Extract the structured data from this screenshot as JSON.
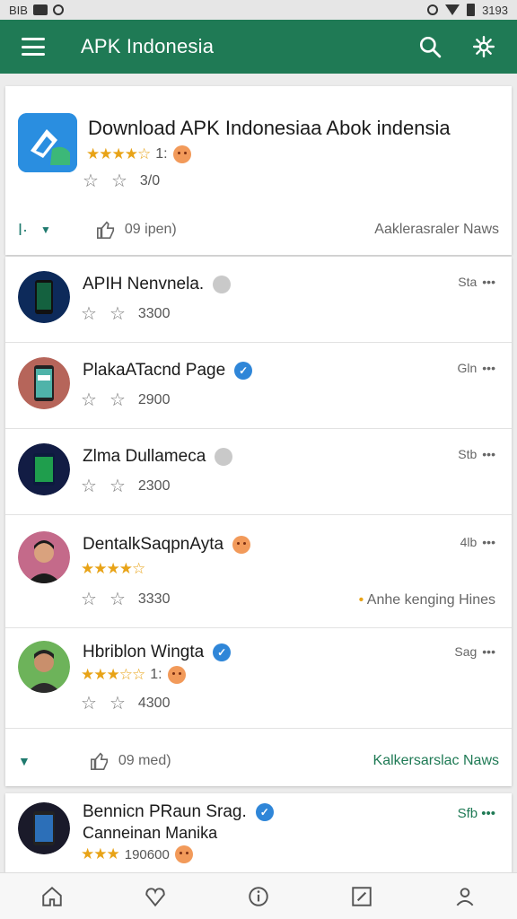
{
  "status_bar": {
    "left_text": "BIB",
    "right_text": "3193"
  },
  "app_bar": {
    "title": "APK Indonesia",
    "menu_icon": "hamburger-icon",
    "search_icon": "search-icon",
    "settings_icon": "gear-icon"
  },
  "featured": {
    "title": "Download APK Indonesiaa Abok indensia",
    "rating_count": "1:",
    "meta_value": "3/0",
    "footer_left": "I·",
    "like_text": "09 ipen)",
    "footer_right": "Aaklerasraler Naws"
  },
  "items": [
    {
      "name": "APIH Nenvnela.",
      "badge": "grey",
      "time": "Sta",
      "meta": "3300",
      "rating": "",
      "side": ""
    },
    {
      "name": "PlakaATacnd Page",
      "badge": "blue",
      "time": "Gln",
      "meta": "2900",
      "rating": "",
      "side": ""
    },
    {
      "name": "Zlma Dullameca",
      "badge": "grey",
      "time": "Stb",
      "meta": "2300",
      "rating": "",
      "side": ""
    },
    {
      "name": "DentalkSaqpnAyta",
      "badge": "emoji",
      "time": "4lb",
      "meta": "3330",
      "rating": "★★★★☆",
      "side": "Anhe kenging Hines"
    },
    {
      "name": "Hbriblon Wingta",
      "badge": "blue",
      "time": "Sag",
      "meta": "4300",
      "rating": "1:",
      "side": ""
    }
  ],
  "list_footer": {
    "like_text": "09 med)",
    "right_text": "Kalkersarslac Naws"
  },
  "partial": {
    "name": "Bennicn PRaun Srag.",
    "sub": "Canneinan Manika",
    "rating": "190600",
    "time": "Sfb"
  },
  "bottom_nav": [
    {
      "label": "home",
      "icon": "home-icon"
    },
    {
      "label": "favorites",
      "icon": "heart-icon"
    },
    {
      "label": "info",
      "icon": "info-icon"
    },
    {
      "label": "edit",
      "icon": "edit-icon"
    },
    {
      "label": "profile",
      "icon": "profile-icon"
    }
  ],
  "colors": {
    "primary": "#1f7a55",
    "star": "#e8a317",
    "verified": "#2f86d8"
  }
}
